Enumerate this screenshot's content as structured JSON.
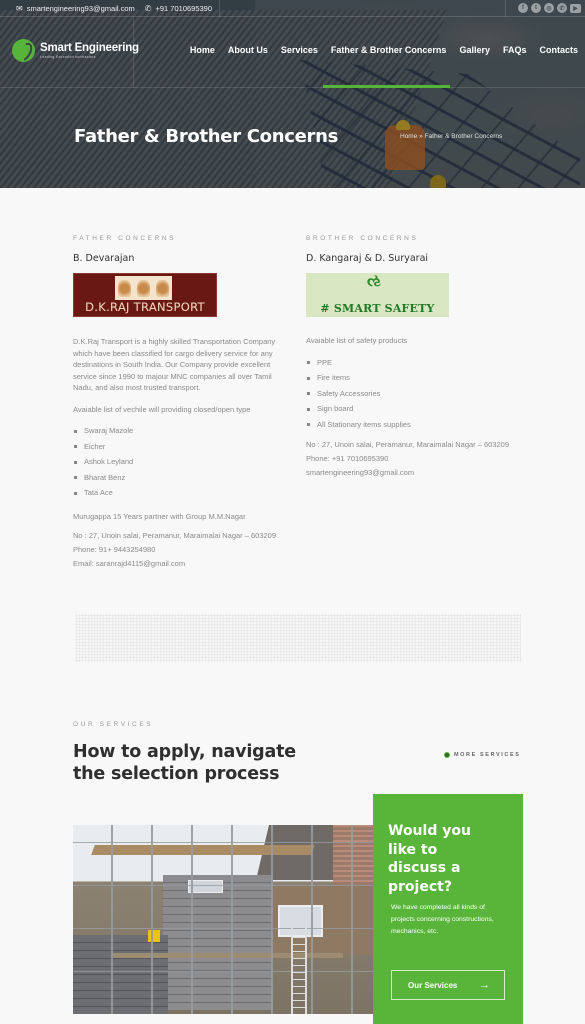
{
  "topbar": {
    "email": "smartengineering93@gmail.com",
    "phone": "+91 7010695390",
    "social": [
      {
        "name": "facebook-icon",
        "glyph": "f"
      },
      {
        "name": "twitter-icon",
        "glyph": "t"
      },
      {
        "name": "instagram-icon",
        "glyph": "◎"
      },
      {
        "name": "whatsapp-icon",
        "glyph": "✆"
      },
      {
        "name": "youtube-icon",
        "glyph": "▶"
      }
    ]
  },
  "logo": {
    "name": "Smart Engineering",
    "tagline": "Leading Execution contractors"
  },
  "nav": {
    "items": [
      "Home",
      "About Us",
      "Services",
      "Father & Brother Concerns",
      "Gallery",
      "FAQs",
      "Contacts"
    ],
    "active_index": 3
  },
  "hero": {
    "title": "Father & Brother Concerns",
    "breadcrumb": "Home » Father & Brother Concerns"
  },
  "father": {
    "eyebrow": "FATHER CONCERNS",
    "person": "B. Devarajan",
    "brand_logo_text": "D.K.RAJ TRANSPORT",
    "brand_color": "#6a1814",
    "description": "D.K.Raj Transport is a highly skilled Transportation Company which have been classified for cargo delivery service for any destinations in South India. Our Company provide excellent service since 1990 to majour MNC companies all over Tamil Nadu, and also most trusted transport.",
    "list_intro": "Avaiable list of vechile will providing closed/open type",
    "vehicles": [
      "Swaraj Mazole",
      "Eicher",
      "Ashok Leyland",
      "Bharat Benz",
      "Tata Ace"
    ],
    "partner": "Murugappa 15 Years  partner with Group M.M.Nagar",
    "address": "No : 27, Unoin salai, Peramanur, Maraimalai Nagar – 603209",
    "phone": "Phone: 91+ 9443254980",
    "email": "Email: saranrajd4115@gmail.com"
  },
  "brother": {
    "eyebrow": "BROTHER CONCERNS",
    "person": "D. Kangaraj & D. Suryarai",
    "brand_logo_text": "# SMART SAFETY",
    "brand_color": "#1f7a26",
    "list_intro": "Avaiable list of safety products",
    "products": [
      "PPE",
      "Fire items",
      "Safety Accessories",
      "Sign board",
      "All Stationary items supplies"
    ],
    "address": "No : 27, Unoin salai, Peramanur, Maraimalai Nagar – 603209",
    "phone": "Phone: +91 7010695390",
    "email": "smartengineering93@gmail.com"
  },
  "services": {
    "eyebrow": "OUR SERVICES",
    "title": "How to apply, navigate the selection process",
    "more_link": "MORE SERVICES"
  },
  "cta": {
    "title": "Would you like to discuss a project?",
    "text": "We have completed all kinds of projects concerning constructions, mechanics, etc.",
    "button_label": "Our Services",
    "button_icon": "→"
  },
  "colors": {
    "accent": "#59b53a",
    "heading": "#2f2f2f",
    "body_text": "#8a8a8a",
    "background": "#f8f8f8"
  }
}
